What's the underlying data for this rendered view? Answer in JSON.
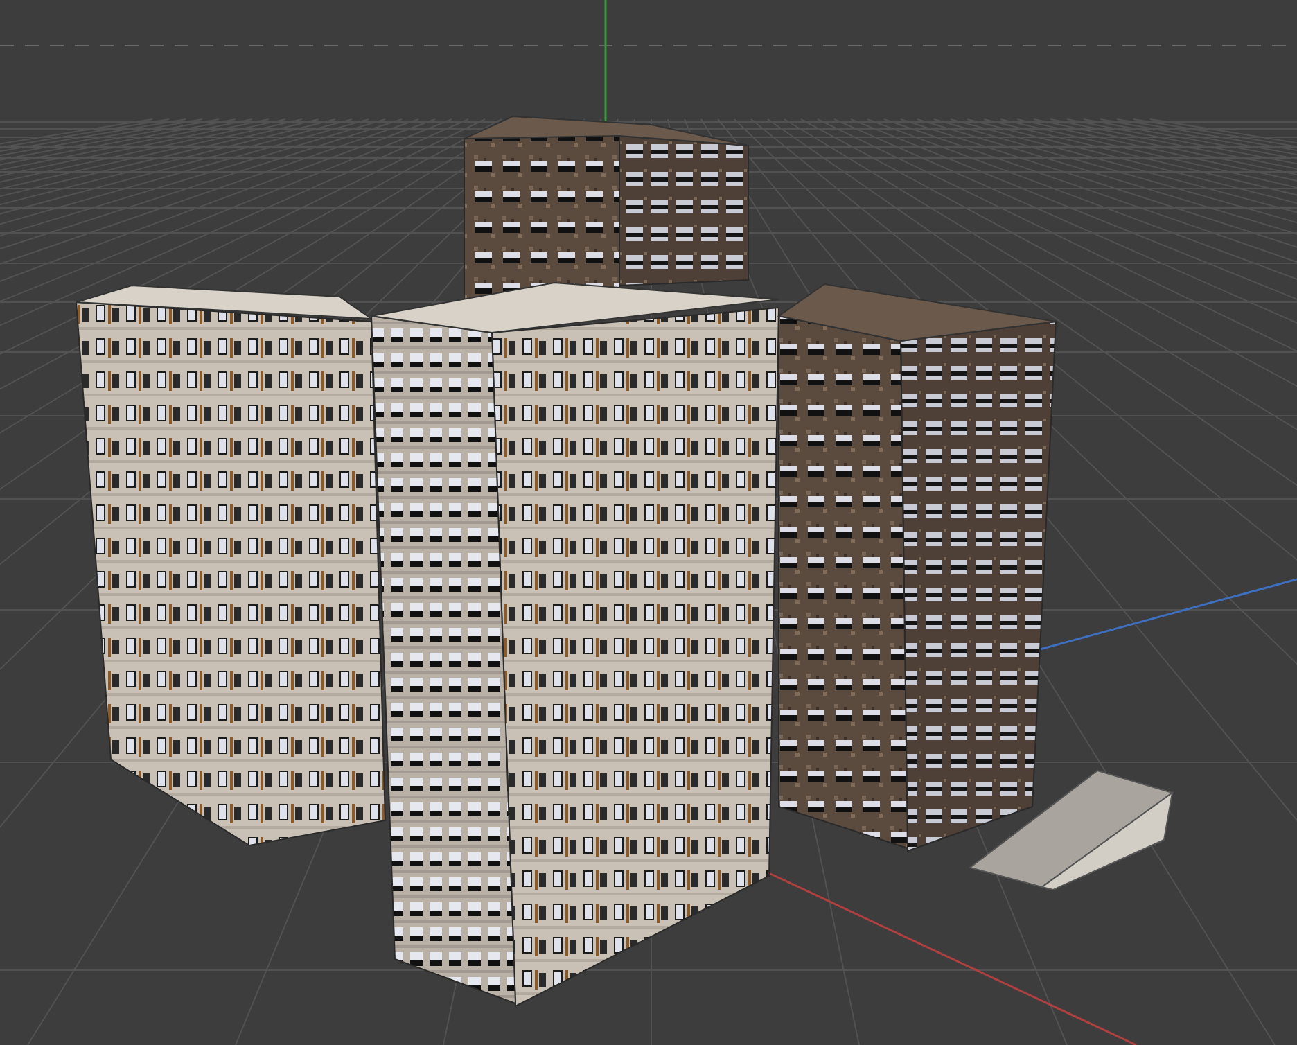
{
  "viewport": {
    "axes": [
      {
        "kind": "red"
      },
      {
        "kind": "green"
      },
      {
        "kind": "blue"
      }
    ],
    "buildings": [
      {
        "kind": "brick"
      },
      {
        "kind": "panel"
      },
      {
        "kind": "panel"
      },
      {
        "kind": "brick"
      }
    ],
    "objects": [
      {
        "kind": "ramp"
      }
    ]
  }
}
